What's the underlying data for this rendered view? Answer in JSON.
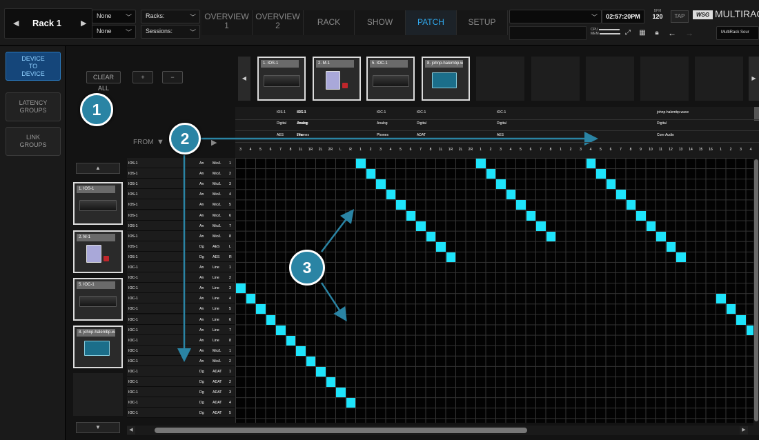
{
  "topbar": {
    "rack_name": "Rack 1",
    "prev_icon": "triangle-left",
    "next_icon": "triangle-right",
    "select1": "None",
    "select2": "None",
    "racks_label": "Racks:",
    "sessions_label": "Sessions:",
    "tabs": [
      {
        "l1": "OVERVIEW",
        "l2": "1"
      },
      {
        "l1": "OVERVIEW",
        "l2": "2"
      },
      {
        "l1": "RACK",
        "l2": ""
      },
      {
        "l1": "SHOW",
        "l2": ""
      },
      {
        "l1": "PATCH",
        "l2": ""
      },
      {
        "l1": "SETUP",
        "l2": ""
      }
    ],
    "active_tab": "PATCH",
    "time": "02:57:20PM",
    "bpm_label": "BPM",
    "bpm_value": "120",
    "tap_label": "TAP",
    "brand_logo": "WSG",
    "brand_name": "MULTIRACK",
    "cpu_label": "CPU",
    "mem_label": "MEM",
    "source_select": "MultiRack Sour",
    "accent": "#2fa9ee"
  },
  "sidebar": {
    "items": [
      {
        "label": "DEVICE TO DEVICE",
        "active": true
      },
      {
        "label": "LATENCY GROUPS",
        "active": false
      },
      {
        "label": "LINK GROUPS",
        "active": false
      }
    ]
  },
  "controls": {
    "clear_all": "CLEAR ALL",
    "plus": "+",
    "minus": "−",
    "from_label": "FROM"
  },
  "top_devices": [
    {
      "label": "1. IOS-1",
      "kind": "rack"
    },
    {
      "label": "2. M-1",
      "kind": "box"
    },
    {
      "label": "5. IOC-1",
      "kind": "rack"
    },
    {
      "label": "8. johnp-halembp.wav",
      "kind": "laptop"
    }
  ],
  "left_devices": [
    {
      "label": "1. IOS-1",
      "kind": "rack"
    },
    {
      "label": "2. M-1",
      "kind": "box"
    },
    {
      "label": "5. IOC-1",
      "kind": "rack"
    },
    {
      "label": "8. johnp-halembp.wav",
      "kind": "laptop"
    }
  ],
  "col_groups": [
    {
      "device": "IOS-1",
      "type": "Analog",
      "sub": "Phones",
      "span": 6
    },
    {
      "device": "IOS-1",
      "type": "Digital",
      "sub": "AES",
      "span": 2
    },
    {
      "device": "IOC-1",
      "type": "Analog",
      "sub": "Line",
      "span": 8
    },
    {
      "device": "IOC-1",
      "type": "Analog",
      "sub": "Phones",
      "span": 4
    },
    {
      "device": "IOC-1",
      "type": "Digital",
      "sub": "ADAT",
      "span": 8
    },
    {
      "device": "IOC-1",
      "type": "Digital",
      "sub": "AES",
      "span": 16
    },
    {
      "device": "johnp-halembp.wave",
      "type": "Digital",
      "sub": "Core Audio",
      "span": 4
    }
  ],
  "col_numbers": [
    "3",
    "4",
    "5",
    "6",
    "7",
    "8",
    "1L",
    "1R",
    "2L",
    "2R",
    "L",
    "R",
    "1",
    "2",
    "3",
    "4",
    "5",
    "6",
    "7",
    "8",
    "1L",
    "1R",
    "2L",
    "2R",
    "1",
    "2",
    "3",
    "4",
    "5",
    "6",
    "7",
    "8",
    "1",
    "2",
    "3",
    "4",
    "5",
    "6",
    "7",
    "8",
    "9",
    "10",
    "11",
    "12",
    "13",
    "14",
    "15",
    "16",
    "1",
    "2",
    "3",
    "4"
  ],
  "rows": [
    {
      "dev": "IOS-1",
      "typ": "An",
      "name": "Mic/L",
      "ch": "1"
    },
    {
      "dev": "IOS-1",
      "typ": "An",
      "name": "Mic/L",
      "ch": "2"
    },
    {
      "dev": "IOS-1",
      "typ": "An",
      "name": "Mic/L",
      "ch": "3"
    },
    {
      "dev": "IOS-1",
      "typ": "An",
      "name": "Mic/L",
      "ch": "4"
    },
    {
      "dev": "IOS-1",
      "typ": "An",
      "name": "Mic/L",
      "ch": "5"
    },
    {
      "dev": "IOS-1",
      "typ": "An",
      "name": "Mic/L",
      "ch": "6"
    },
    {
      "dev": "IOS-1",
      "typ": "An",
      "name": "Mic/L",
      "ch": "7"
    },
    {
      "dev": "IOS-1",
      "typ": "An",
      "name": "Mic/L",
      "ch": "8"
    },
    {
      "dev": "IOS-1",
      "typ": "Dg",
      "name": "AES",
      "ch": "L"
    },
    {
      "dev": "IOS-1",
      "typ": "Dg",
      "name": "AES",
      "ch": "R"
    },
    {
      "dev": "IOC-1",
      "typ": "An",
      "name": "Line",
      "ch": "1"
    },
    {
      "dev": "IOC-1",
      "typ": "An",
      "name": "Line",
      "ch": "2"
    },
    {
      "dev": "IOC-1",
      "typ": "An",
      "name": "Line",
      "ch": "3"
    },
    {
      "dev": "IOC-1",
      "typ": "An",
      "name": "Line",
      "ch": "4"
    },
    {
      "dev": "IOC-1",
      "typ": "An",
      "name": "Line",
      "ch": "5"
    },
    {
      "dev": "IOC-1",
      "typ": "An",
      "name": "Line",
      "ch": "6"
    },
    {
      "dev": "IOC-1",
      "typ": "An",
      "name": "Line",
      "ch": "7"
    },
    {
      "dev": "IOC-1",
      "typ": "An",
      "name": "Line",
      "ch": "8"
    },
    {
      "dev": "IOC-1",
      "typ": "An",
      "name": "Mic/L",
      "ch": "1"
    },
    {
      "dev": "IOC-1",
      "typ": "An",
      "name": "Mic/L",
      "ch": "2"
    },
    {
      "dev": "IOC-1",
      "typ": "Dg",
      "name": "ADAT",
      "ch": "1"
    },
    {
      "dev": "IOC-1",
      "typ": "Dg",
      "name": "ADAT",
      "ch": "2"
    },
    {
      "dev": "IOC-1",
      "typ": "Dg",
      "name": "ADAT",
      "ch": "3"
    },
    {
      "dev": "IOC-1",
      "typ": "Dg",
      "name": "ADAT",
      "ch": "4"
    },
    {
      "dev": "IOC-1",
      "typ": "Dg",
      "name": "ADAT",
      "ch": "5"
    }
  ],
  "patches": [
    [
      0,
      12
    ],
    [
      1,
      13
    ],
    [
      2,
      14
    ],
    [
      3,
      15
    ],
    [
      4,
      16
    ],
    [
      5,
      17
    ],
    [
      6,
      18
    ],
    [
      7,
      19
    ],
    [
      8,
      20
    ],
    [
      9,
      21
    ],
    [
      0,
      24
    ],
    [
      1,
      25
    ],
    [
      2,
      26
    ],
    [
      3,
      27
    ],
    [
      4,
      28
    ],
    [
      5,
      29
    ],
    [
      6,
      30
    ],
    [
      7,
      31
    ],
    [
      0,
      35
    ],
    [
      1,
      36
    ],
    [
      2,
      37
    ],
    [
      3,
      38
    ],
    [
      4,
      39
    ],
    [
      5,
      40
    ],
    [
      6,
      41
    ],
    [
      7,
      42
    ],
    [
      8,
      43
    ],
    [
      9,
      44
    ],
    [
      12,
      0
    ],
    [
      13,
      1
    ],
    [
      14,
      2
    ],
    [
      15,
      3
    ],
    [
      16,
      4
    ],
    [
      17,
      5
    ],
    [
      18,
      6
    ],
    [
      19,
      7
    ],
    [
      20,
      8
    ],
    [
      21,
      9
    ],
    [
      22,
      10
    ],
    [
      23,
      11
    ],
    [
      13,
      48
    ],
    [
      14,
      49
    ],
    [
      15,
      50
    ],
    [
      16,
      51
    ]
  ],
  "callouts": [
    "1",
    "2",
    "3"
  ],
  "colors": {
    "patch": "#1ee4fb",
    "callout": "#2a84a4"
  }
}
